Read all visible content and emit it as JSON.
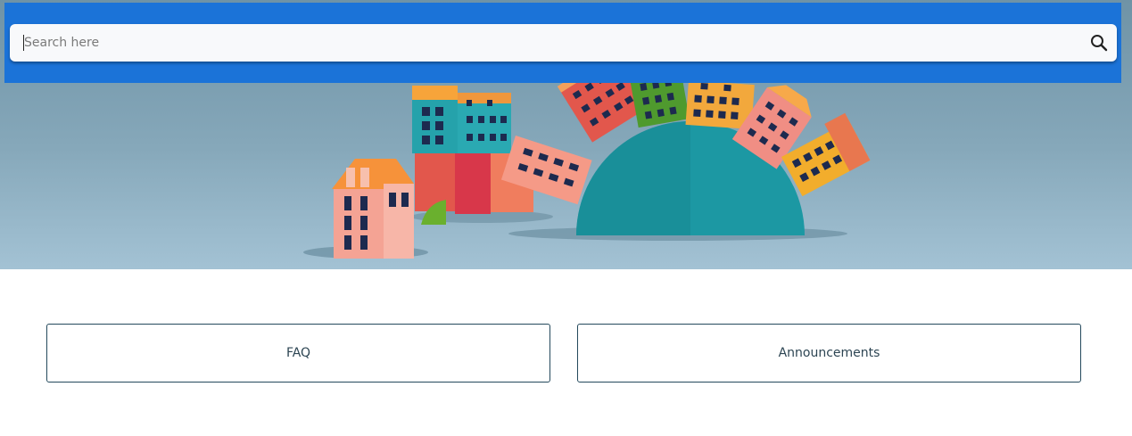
{
  "search": {
    "placeholder": "Search here"
  },
  "cards": [
    {
      "label": "FAQ"
    },
    {
      "label": "Announcements"
    }
  ],
  "colors": {
    "header_band": "#1b73d8",
    "card_border": "#24495c",
    "hero_sky": "#86a8ba"
  },
  "icons": {
    "search": "magnifier-icon"
  }
}
